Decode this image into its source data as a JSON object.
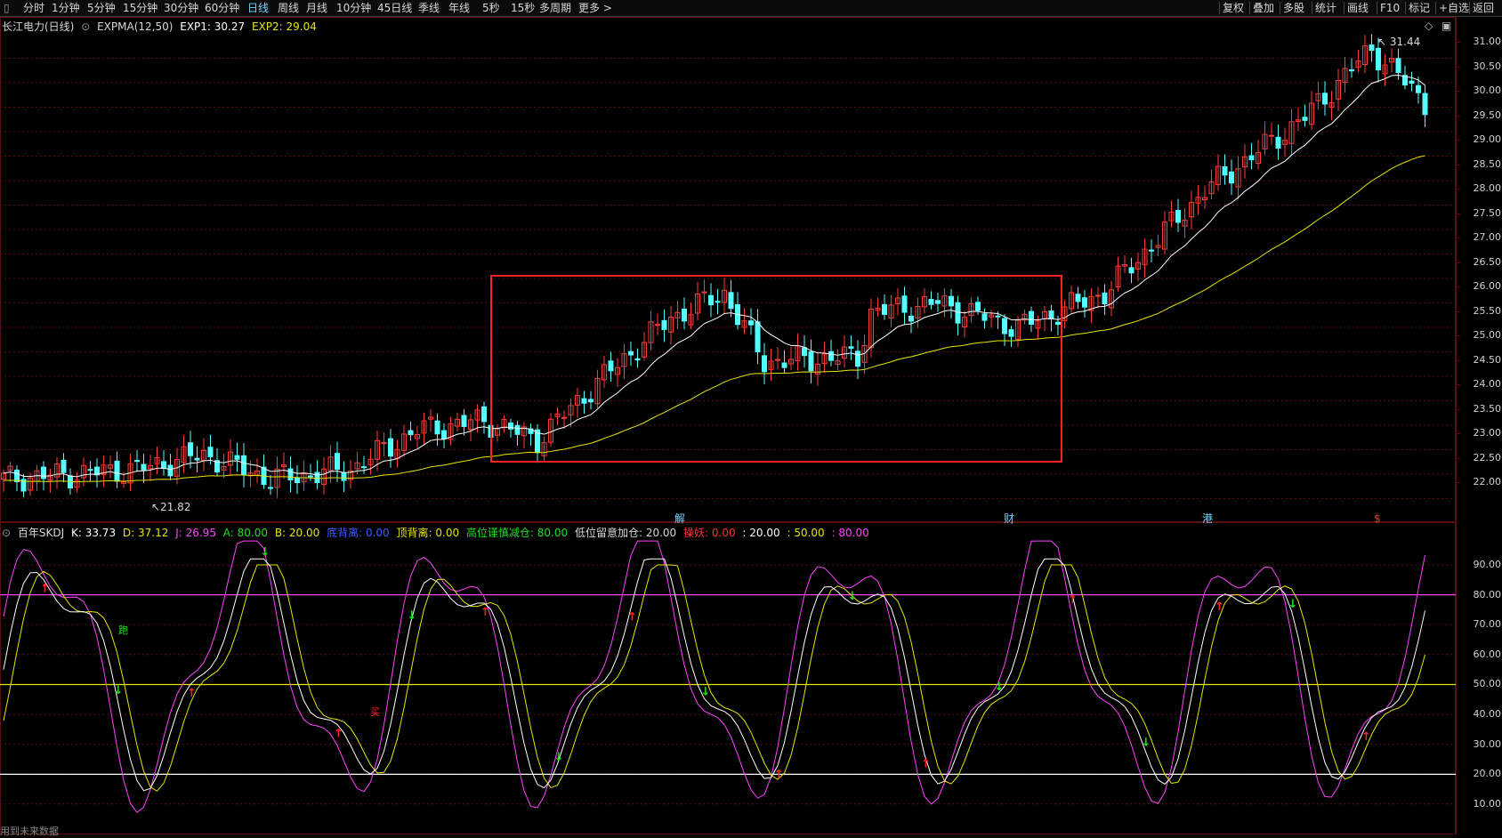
{
  "toolbar": {
    "left_items": [
      "分时",
      "1分钟",
      "5分钟",
      "15分钟",
      "30分钟",
      "60分钟",
      "日线",
      "周线",
      "月线",
      "10分钟",
      "45日线",
      "季线",
      "年线",
      "5秒",
      "15秒",
      "多周期",
      "更多 >"
    ],
    "active": "日线",
    "right_items": [
      "复权",
      "叠加",
      "多股",
      "统计",
      "画线",
      "F10",
      "标记",
      "+自选",
      "返回"
    ]
  },
  "main_legend": {
    "title": "长江电力(日线)",
    "indicator": "EXPMA(12,50)",
    "exp1_label": "EXP1: 30.27",
    "exp2_label": "EXP2: 29.04"
  },
  "price_axis": {
    "ticks": [
      "31.00",
      "30.50",
      "30.00",
      "29.50",
      "29.00",
      "28.50",
      "28.00",
      "27.50",
      "27.00",
      "26.50",
      "26.00",
      "25.50",
      "25.00",
      "24.50",
      "24.00",
      "23.50",
      "23.00",
      "22.50",
      "22.00"
    ]
  },
  "annotations": {
    "high_label": "31.44",
    "low_label": "21.82",
    "event_markers": [
      "解",
      "财",
      "港",
      "$"
    ]
  },
  "indicator_legend": {
    "name": "百年SKDJ",
    "k": "K: 33.73",
    "d": "D: 37.12",
    "j": "J: 26.95",
    "a": "A: 80.00",
    "b": "B: 20.00",
    "bottom_div": "底背离: 0.00",
    "top_div": "顶背离: 0.00",
    "high_reduce": "高位谨慎减仓: 80.00",
    "low_add": "低位留意加仓: 20.00",
    "warn": "操妖: 0.00",
    "v20": ": 20.00",
    "v50": ": 50.00",
    "v80": ": 80.00"
  },
  "ind_axis": {
    "ticks": [
      "90.00",
      "80.00",
      "70.00",
      "60.00",
      "50.00",
      "40.00",
      "30.00",
      "20.00",
      "10.00"
    ]
  },
  "signals": {
    "buy": "买",
    "run": "跑"
  },
  "footer_text": "用到未来数据",
  "colors": {
    "up": "#ff3c3c",
    "down": "#54ffff",
    "exp1": "#ffffff",
    "exp2": "#e6e600",
    "k": "#ffffff",
    "d": "#e6e600",
    "j": "#ff44ff",
    "line80": "#ff44ff",
    "line50": "#e6e600",
    "line20": "#ffffff",
    "box": "#ff2020",
    "buy": "#ff2020",
    "sell": "#22dd22"
  }
}
